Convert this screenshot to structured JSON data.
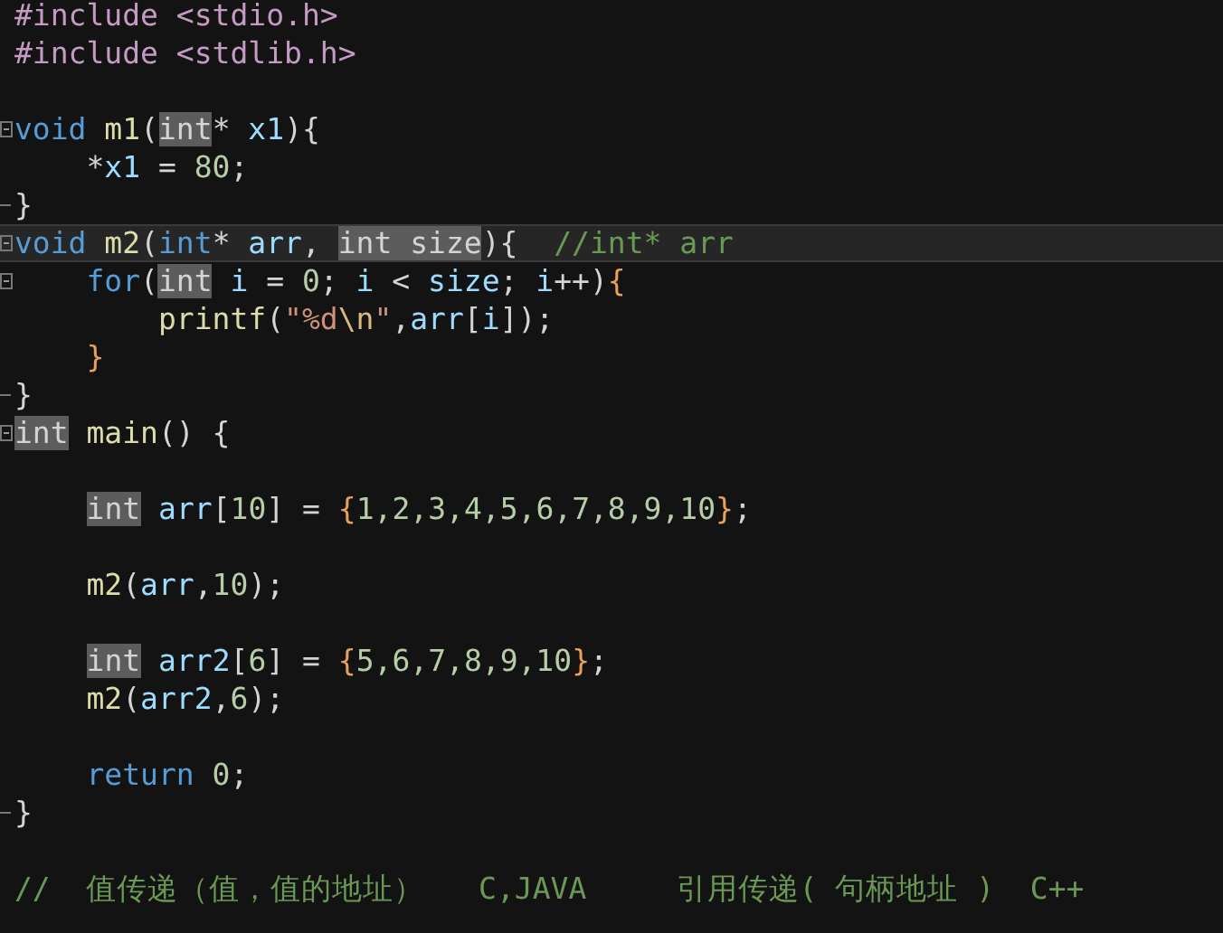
{
  "editor": {
    "lines": [
      {
        "fold_start": false,
        "fold_end": false,
        "current": false,
        "tokens": [
          {
            "kind": "pp",
            "text": "#include"
          },
          {
            "kind": "pp",
            "text": " <stdio.h>"
          }
        ]
      },
      {
        "fold_start": false,
        "fold_end": false,
        "current": false,
        "tokens": [
          {
            "kind": "pp",
            "text": "#include"
          },
          {
            "kind": "pp",
            "text": " <stdlib.h>"
          }
        ]
      },
      {
        "fold_start": false,
        "fold_end": false,
        "current": false
      },
      {
        "fold_start": true,
        "fold_end": false,
        "current": false,
        "tokens": [
          {
            "kind": "kw",
            "text": "void"
          },
          {
            "kind": "fn",
            "text": " m1"
          },
          {
            "kind": "punct",
            "text": "("
          },
          {
            "kind": "hl",
            "text": "int"
          },
          {
            "kind": "punct",
            "text": "*"
          },
          {
            "kind": "var",
            "text": " x1"
          },
          {
            "kind": "punct",
            "text": "){"
          }
        ]
      },
      {
        "fold_start": false,
        "fold_end": false,
        "current": false,
        "tokens": [
          {
            "kind": "punct",
            "text": "    *"
          },
          {
            "kind": "var",
            "text": "x1"
          },
          {
            "kind": "punct",
            "text": " = "
          },
          {
            "kind": "num",
            "text": "80"
          },
          {
            "kind": "punct",
            "text": ";"
          }
        ]
      },
      {
        "fold_start": false,
        "fold_end": true,
        "current": false,
        "tokens": [
          {
            "kind": "punct",
            "text": "}"
          }
        ]
      },
      {
        "fold_start": true,
        "fold_end": false,
        "current": true,
        "tokens": [
          {
            "kind": "kw",
            "text": "void"
          },
          {
            "kind": "fn",
            "text": " m2"
          },
          {
            "kind": "punct",
            "text": "("
          },
          {
            "kind": "kw",
            "text": "int"
          },
          {
            "kind": "punct",
            "text": "*"
          },
          {
            "kind": "var",
            "text": " arr"
          },
          {
            "kind": "punct",
            "text": ", "
          },
          {
            "kind": "hl",
            "text": "int size"
          },
          {
            "kind": "punct",
            "text": "){"
          },
          {
            "kind": "comment",
            "text": "  //int* arr"
          }
        ]
      },
      {
        "fold_start": true,
        "fold_end": false,
        "current": false,
        "tokens": [
          {
            "kind": "kw",
            "text": "    for"
          },
          {
            "kind": "punct",
            "text": "("
          },
          {
            "kind": "hl",
            "text": "int"
          },
          {
            "kind": "var",
            "text": " i"
          },
          {
            "kind": "punct",
            "text": " = "
          },
          {
            "kind": "num",
            "text": "0"
          },
          {
            "kind": "punct",
            "text": ";"
          },
          {
            "kind": "var",
            "text": " i"
          },
          {
            "kind": "punct",
            "text": " < "
          },
          {
            "kind": "var",
            "text": "size"
          },
          {
            "kind": "punct",
            "text": ";"
          },
          {
            "kind": "var",
            "text": " i"
          },
          {
            "kind": "punct",
            "text": "++)"
          },
          {
            "kind": "brace",
            "text": "{"
          }
        ]
      },
      {
        "fold_start": false,
        "fold_end": false,
        "current": false,
        "tokens": [
          {
            "kind": "fn",
            "text": "        printf"
          },
          {
            "kind": "punct",
            "text": "("
          },
          {
            "kind": "str",
            "text": "\"%d"
          },
          {
            "kind": "esc",
            "text": "\\n"
          },
          {
            "kind": "str",
            "text": "\""
          },
          {
            "kind": "punct",
            "text": ","
          },
          {
            "kind": "var",
            "text": "arr"
          },
          {
            "kind": "punct",
            "text": "["
          },
          {
            "kind": "var",
            "text": "i"
          },
          {
            "kind": "punct",
            "text": "]);"
          }
        ]
      },
      {
        "fold_start": false,
        "fold_end": false,
        "current": false,
        "tokens": [
          {
            "kind": "brace",
            "text": "    }"
          }
        ]
      },
      {
        "fold_start": false,
        "fold_end": true,
        "current": false,
        "tokens": [
          {
            "kind": "punct",
            "text": "}"
          }
        ]
      },
      {
        "fold_start": true,
        "fold_end": false,
        "current": false,
        "tokens": [
          {
            "kind": "hl",
            "text": "int"
          },
          {
            "kind": "fn",
            "text": " main"
          },
          {
            "kind": "punct",
            "text": "() {"
          }
        ]
      },
      {
        "fold_start": false,
        "fold_end": false,
        "current": false
      },
      {
        "fold_start": false,
        "fold_end": false,
        "current": false,
        "tokens": [
          {
            "kind": "hl",
            "text": "int",
            "indent": true
          },
          {
            "kind": "var",
            "text": " arr"
          },
          {
            "kind": "punct",
            "text": "["
          },
          {
            "kind": "num",
            "text": "10"
          },
          {
            "kind": "punct",
            "text": "] = "
          },
          {
            "kind": "brace",
            "text": "{"
          },
          {
            "kind": "num",
            "text": "1,2,3,4,5,6,7,8,9,10"
          },
          {
            "kind": "brace",
            "text": "}"
          },
          {
            "kind": "punct",
            "text": ";"
          }
        ]
      },
      {
        "fold_start": false,
        "fold_end": false,
        "current": false
      },
      {
        "fold_start": false,
        "fold_end": false,
        "current": false,
        "tokens": [
          {
            "kind": "fn",
            "text": "    m2"
          },
          {
            "kind": "punct",
            "text": "("
          },
          {
            "kind": "var",
            "text": "arr"
          },
          {
            "kind": "punct",
            "text": ","
          },
          {
            "kind": "num",
            "text": "10"
          },
          {
            "kind": "punct",
            "text": ");"
          }
        ]
      },
      {
        "fold_start": false,
        "fold_end": false,
        "current": false
      },
      {
        "fold_start": false,
        "fold_end": false,
        "current": false,
        "tokens": [
          {
            "kind": "hl",
            "text": "int",
            "indent": true
          },
          {
            "kind": "var",
            "text": " arr2"
          },
          {
            "kind": "punct",
            "text": "["
          },
          {
            "kind": "num",
            "text": "6"
          },
          {
            "kind": "punct",
            "text": "] = "
          },
          {
            "kind": "brace",
            "text": "{"
          },
          {
            "kind": "num",
            "text": "5,6,7,8,9,10"
          },
          {
            "kind": "brace",
            "text": "}"
          },
          {
            "kind": "punct",
            "text": ";"
          }
        ]
      },
      {
        "fold_start": false,
        "fold_end": false,
        "current": false,
        "tokens": [
          {
            "kind": "fn",
            "text": "    m2"
          },
          {
            "kind": "punct",
            "text": "("
          },
          {
            "kind": "var",
            "text": "arr2"
          },
          {
            "kind": "punct",
            "text": ","
          },
          {
            "kind": "num",
            "text": "6"
          },
          {
            "kind": "punct",
            "text": ");"
          }
        ]
      },
      {
        "fold_start": false,
        "fold_end": false,
        "current": false
      },
      {
        "fold_start": false,
        "fold_end": false,
        "current": false,
        "tokens": [
          {
            "kind": "kw",
            "text": "    return"
          },
          {
            "kind": "num",
            "text": " 0"
          },
          {
            "kind": "punct",
            "text": ";"
          }
        ]
      },
      {
        "fold_start": false,
        "fold_end": true,
        "current": false,
        "tokens": [
          {
            "kind": "punct",
            "text": "}"
          }
        ]
      },
      {
        "fold_start": false,
        "fold_end": false,
        "current": false
      },
      {
        "fold_start": false,
        "fold_end": false,
        "current": false,
        "tokens": [
          {
            "kind": "comment",
            "text": "//  值传递（值，值的地址）   C,JAVA     引用传递( 句柄地址 )  C++"
          }
        ]
      }
    ]
  }
}
